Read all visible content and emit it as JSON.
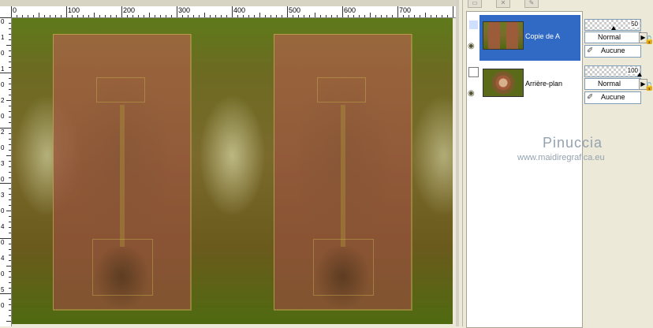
{
  "canvas": {
    "ruler_top_labels": [
      "0",
      "100",
      "200",
      "300",
      "400",
      "500",
      "600",
      "700"
    ],
    "ruler_left_labels": [
      "0",
      "1",
      "0",
      "1",
      "0",
      "2",
      "0",
      "2",
      "0",
      "3",
      "0",
      "3",
      "0",
      "4",
      "0",
      "4",
      "0",
      "5",
      "0"
    ]
  },
  "layers": {
    "items": [
      {
        "name": "Copie de A",
        "selected": true,
        "opacity": "50",
        "opacity_fraction": 0.5,
        "blend": "Normal",
        "mask": "Aucune"
      },
      {
        "name": "Arrière-plan",
        "selected": false,
        "opacity": "100",
        "opacity_fraction": 1.0,
        "blend": "Normal",
        "mask": "Aucune"
      }
    ]
  },
  "watermark": {
    "title": "Pinuccia",
    "url": "www.maidiregrafica.eu"
  },
  "icons": {
    "visibility": "eye-icon",
    "lock": "lock-icon",
    "mask_brush": "brush-icon",
    "blend_dropdown": "triangle-right-icon"
  },
  "colors": {
    "selection": "#316AC5",
    "panel_bg": "#ECE9D8"
  }
}
